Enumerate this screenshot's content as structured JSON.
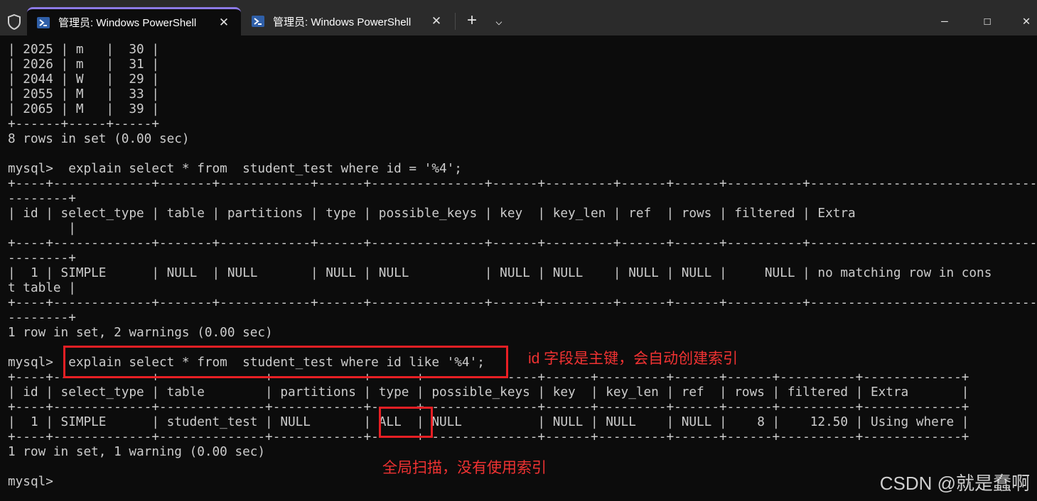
{
  "titlebar": {
    "tabs": [
      {
        "label": "管理员: Windows PowerShell",
        "active": true,
        "close": "✕"
      },
      {
        "label": "管理员: Windows PowerShell",
        "active": false,
        "close": "✕"
      }
    ],
    "new_tab": "+",
    "dropdown": "⌵",
    "minimize": "—",
    "maximize": "☐",
    "close": "✕",
    "icons": [
      "shield-icon",
      "powershell-icon",
      "plus-icon",
      "chevron-down-icon",
      "minimize-icon",
      "maximize-icon",
      "close-icon"
    ],
    "accent_color": "#8c7ae6"
  },
  "terminal": {
    "lines": [
      "| 2025 | m   |  30 |",
      "| 2026 | m   |  31 |",
      "| 2044 | W   |  29 |",
      "| 2055 | M   |  33 |",
      "| 2065 | M   |  39 |",
      "+------+-----+-----+",
      "8 rows in set (0.00 sec)",
      "",
      "mysql>  explain select * from  student_test where id = '%4';",
      "+----+-------------+-------+------------+------+---------------+------+---------+------+------+----------+--------------------------------",
      "--------+",
      "| id | select_type | table | partitions | type | possible_keys | key  | key_len | ref  | rows | filtered | Extra",
      "        |",
      "+----+-------------+-------+------------+------+---------------+------+---------+------+------+----------+--------------------------------",
      "--------+",
      "|  1 | SIMPLE      | NULL  | NULL       | NULL | NULL          | NULL | NULL    | NULL | NULL |     NULL | no matching row in cons",
      "t table |",
      "+----+-------------+-------+------------+------+---------------+------+---------+------+------+----------+--------------------------------",
      "--------+",
      "1 row in set, 2 warnings (0.00 sec)",
      "",
      "mysql>  explain select * from  student_test where id like '%4';",
      "+----+-------------+--------------+------------+------+---------------+------+---------+------+------+----------+-------------+",
      "| id | select_type | table        | partitions | type | possible_keys | key  | key_len | ref  | rows | filtered | Extra       |",
      "+----+-------------+--------------+------------+------+---------------+------+---------+------+------+----------+-------------+",
      "|  1 | SIMPLE      | student_test | NULL       | ALL  | NULL          | NULL | NULL    | NULL |    8 |    12.50 | Using where |",
      "+----+-------------+--------------+------------+------+---------------+------+---------+------+------+----------+-------------+",
      "1 row in set, 1 warning (0.00 sec)",
      "",
      "mysql>"
    ],
    "text_color": "#cccccc",
    "background": "#0c0c0c"
  },
  "annotations": {
    "primary_key_note": "id 字段是主键，会自动创建索引",
    "full_scan_note": "全局扫描，没有使用索引",
    "color": "#e81f24"
  },
  "watermark": "CSDN @就是蠢啊"
}
